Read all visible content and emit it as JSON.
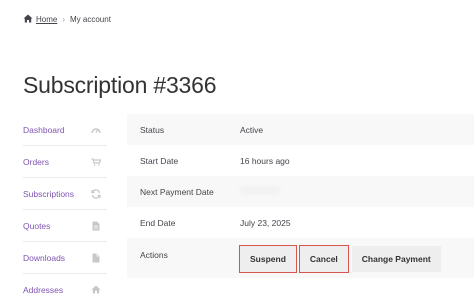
{
  "breadcrumb": {
    "home": "Home",
    "separator": "›",
    "current": "My account"
  },
  "page": {
    "title": "Subscription #3366"
  },
  "nav": {
    "items": [
      {
        "label": "Dashboard",
        "icon": "gauge-icon"
      },
      {
        "label": "Orders",
        "icon": "cart-icon"
      },
      {
        "label": "Subscriptions",
        "icon": "refresh-icon"
      },
      {
        "label": "Quotes",
        "icon": "document-icon"
      },
      {
        "label": "Downloads",
        "icon": "file-icon"
      },
      {
        "label": "Addresses",
        "icon": "home-icon"
      }
    ]
  },
  "details": {
    "status_label": "Status",
    "status_value": "Active",
    "start_label": "Start Date",
    "start_value": "16 hours ago",
    "next_payment_label": "Next Payment Date",
    "end_label": "End Date",
    "end_value": "July 23, 2025",
    "actions_label": "Actions"
  },
  "actions": {
    "suspend": "Suspend",
    "cancel": "Cancel",
    "change_payment": "Change Payment"
  },
  "colors": {
    "link": "#7f54b3",
    "highlight": "#d9534f",
    "row_alt": "#f8f8f8",
    "button_bg": "#eeeeee"
  }
}
